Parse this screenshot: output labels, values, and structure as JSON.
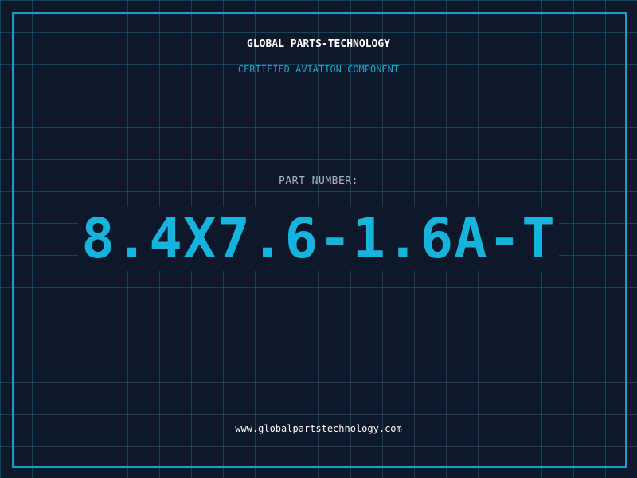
{
  "header": {
    "company_name": "GLOBAL PARTS-TECHNOLOGY",
    "subtitle": "CERTIFIED AVIATION COMPONENT"
  },
  "part": {
    "label": "PART NUMBER:",
    "number": "8.4X7.6-1.6A-T"
  },
  "footer": {
    "url": "www.globalpartstechnology.com"
  },
  "colors": {
    "background": "#0f172b",
    "grid": "#106e82",
    "accent": "#16b3dc",
    "frame": "#1a9bc4",
    "label": "#a8b4c6",
    "text": "#ffffff"
  }
}
